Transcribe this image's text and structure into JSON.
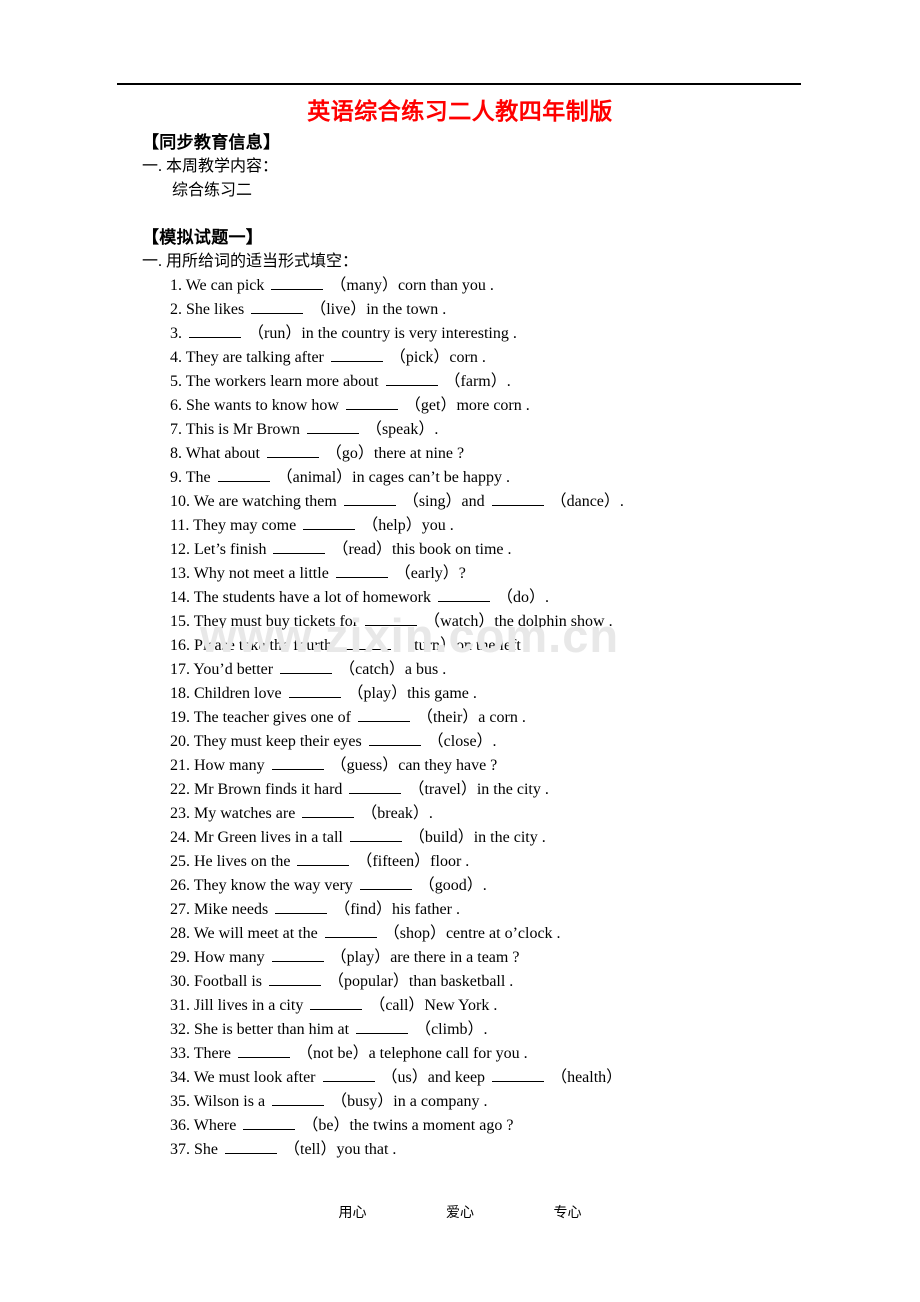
{
  "document": {
    "title": "英语综合练习二人教四年制版",
    "title_color": "#ff0000",
    "section_info_heading": "【同步教育信息】",
    "week_content_label": "一. 本周教学内容：",
    "week_content_value": "综合练习二",
    "exam_heading": "【模拟试题一】",
    "part_one_label": "一. 用所给词的适当形式填空："
  },
  "watermark": {
    "text": "www.zixin.com.cn",
    "color": "#e8e8e8"
  },
  "footer": {
    "items": [
      "用心",
      "爱心",
      "专心"
    ]
  },
  "questions": [
    {
      "num": "1.",
      "before": "We can pick",
      "after": "（many）corn than you ."
    },
    {
      "num": "2.",
      "before": "She likes",
      "after": "（live）in the town ."
    },
    {
      "num": "3.",
      "before": "",
      "after": "（run）in the country is very interesting ."
    },
    {
      "num": "4.",
      "before": "They are talking after",
      "after": "（pick）corn ."
    },
    {
      "num": "5.",
      "before": "The workers learn more about",
      "after": "（farm）."
    },
    {
      "num": "6.",
      "before": "She wants to know how",
      "after": "（get）more corn ."
    },
    {
      "num": "7.",
      "before": "This is Mr Brown",
      "after": "（speak）."
    },
    {
      "num": "8.",
      "before": "What about",
      "after": "（go）there at nine ?"
    },
    {
      "num": "9.",
      "before": "The",
      "after": "（animal）in cages can’t be happy ."
    },
    {
      "num": "10.",
      "before": "We are watching them",
      "after": "（sing）and",
      "after2": "（dance）.",
      "blanks": 2
    },
    {
      "num": "11.",
      "before": "They may come",
      "after": "（help）you ."
    },
    {
      "num": "12.",
      "before": "Let’s finish",
      "after": "（read）this book on time ."
    },
    {
      "num": "13.",
      "before": "Why not meet a little",
      "after": "（early）?"
    },
    {
      "num": "14.",
      "before": "The students have a lot of homework",
      "after": "（do）."
    },
    {
      "num": "15.",
      "before": "They must buy tickets for",
      "after": "（watch）the dolphin show ."
    },
    {
      "num": "16.",
      "before": "Please take the fourth",
      "after": "（turn）on the left ."
    },
    {
      "num": "17.",
      "before": "You’d better",
      "after": "（catch）a bus ."
    },
    {
      "num": "18.",
      "before": "Children love",
      "after": "（play）this game ."
    },
    {
      "num": "19.",
      "before": "The teacher gives one of",
      "after": "（their）a corn ."
    },
    {
      "num": "20.",
      "before": "They must keep their eyes",
      "after": "（close）."
    },
    {
      "num": "21.",
      "before": "How many",
      "after": "（guess）can they have ?"
    },
    {
      "num": "22.",
      "before": "Mr Brown finds it hard",
      "after": "（travel）in the city ."
    },
    {
      "num": "23.",
      "before": "My watches are",
      "after": "（break）."
    },
    {
      "num": "24.",
      "before": "Mr Green lives in a tall",
      "after": "（build）in the city ."
    },
    {
      "num": "25.",
      "before": "He lives on the",
      "after": "（fifteen）floor ."
    },
    {
      "num": "26.",
      "before": "They know the way very",
      "after": "（good）."
    },
    {
      "num": "27.",
      "before": "Mike needs",
      "after": "（find）his father ."
    },
    {
      "num": "28.",
      "before": "We will meet at the",
      "after": "（shop）centre at o’clock ."
    },
    {
      "num": "29.",
      "before": "How many",
      "after": "（play）are there in a team ?"
    },
    {
      "num": "30.",
      "before": "Football is",
      "after": "（popular）than basketball ."
    },
    {
      "num": "31.",
      "before": "Jill lives in a city",
      "after": "（call）New York ."
    },
    {
      "num": "32.",
      "before": "She is better than him at",
      "after": "（climb）."
    },
    {
      "num": "33.",
      "before": "There",
      "after": "（not be）a telephone call for you ."
    },
    {
      "num": "34.",
      "before": "We must look after",
      "after": "（us）and keep",
      "after2": "（health）",
      "blanks": 2
    },
    {
      "num": "35.",
      "before": "Wilson is a",
      "after": "（busy）in a company ."
    },
    {
      "num": "36.",
      "before": "Where",
      "after": "（be）the twins a moment ago ?"
    },
    {
      "num": "37.",
      "before": "She",
      "after": "（tell）you that ."
    }
  ]
}
